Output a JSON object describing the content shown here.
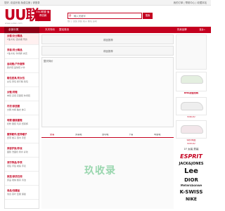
{
  "topbar": {
    "left_text": "您好, 欢迎光临 免费注册 | 请登录",
    "right_links": "我的订单 | 帮助中心 | 收藏本站"
  },
  "header": {
    "logo": "UU联",
    "logo_badge": "ESC联盟 值得信赖",
    "logo_tagline": "www.uulian.com",
    "search_placeholder": "输入关键字",
    "search_button": "搜索",
    "hot_words": "热门: 女装 男装 鞋子 箱包 运动"
  },
  "nav": {
    "all_categories": "全部分类",
    "items": [
      "天天特价",
      "整站首页"
    ]
  },
  "sidebar": {
    "categories": [
      {
        "title": "女装/女士精品",
        "sub": "T恤 衬衫 连衣裙 雪纺"
      },
      {
        "title": "男装/男士精品",
        "sub": "T恤 衬衫 休闲裤 夹克"
      },
      {
        "title": "运动鞋/户外服饰",
        "sub": "跑步鞋 篮球鞋 户外"
      },
      {
        "title": "箱包皮具/男女包",
        "sub": "女包 男包 旅行箱 钱包"
      },
      {
        "title": "女鞋/男鞋",
        "sub": "单鞋 凉鞋 高跟鞋 休闲鞋"
      },
      {
        "title": "内衣/家居服",
        "sub": "文胸 内裤 睡衣 袜子"
      },
      {
        "title": "母婴/童装童鞋",
        "sub": "奶粉 童装 玩具 纸尿裤"
      },
      {
        "title": "服饰配件/皮带帽子",
        "sub": "皮带 帽子 围巾 手套"
      },
      {
        "title": "美容护肤/彩妆",
        "sub": "面膜 洗面奶 香水 彩妆"
      },
      {
        "title": "流行饰品/手表",
        "sub": "项链 手链 戒指 手表"
      },
      {
        "title": "家居/家纺日用",
        "sub": "床品 收纳 餐具 清洁"
      },
      {
        "title": "食品/保健品",
        "sub": "零食 茶叶 坚果 保健"
      }
    ]
  },
  "main": {
    "band1_title": "精品推荐",
    "band2_title": "精品推荐",
    "band2_left": "整天特价",
    "tabs": [
      "女装",
      "男装鞋",
      "运动鞋",
      "下装",
      "母婴鞋"
    ]
  },
  "right": {
    "header": "热卖品牌",
    "more": "更多>",
    "promo1": "BNS超值抢购",
    "promo2": "¥38.00",
    "promo3": "特价商品",
    "promo4": "¥39.00",
    "floor_label": "1F 女装 男装",
    "brands": [
      "ESPRIT",
      "JACK&JONES",
      "Lee",
      "DIOR",
      "Metersbonwe",
      "K-SWISS",
      "NIKE"
    ]
  },
  "watermark": "玖收录"
}
